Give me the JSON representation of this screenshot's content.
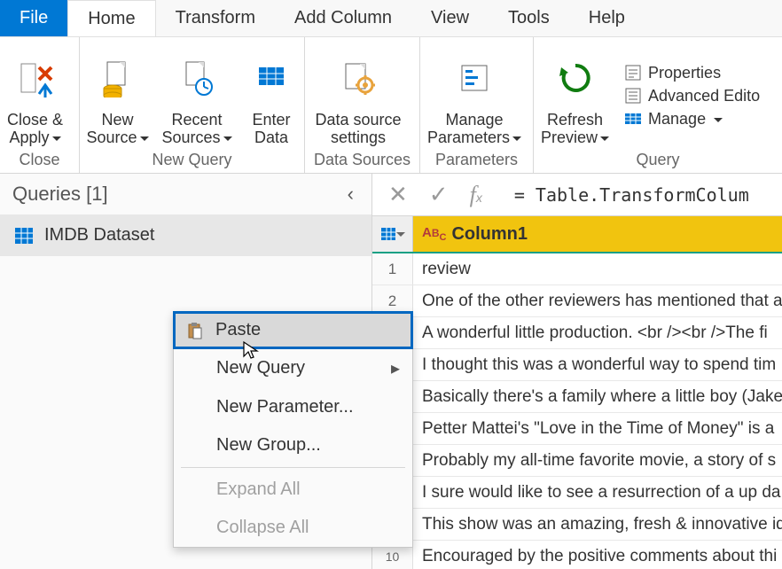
{
  "menubar": {
    "file": "File",
    "tabs": [
      "Home",
      "Transform",
      "Add Column",
      "View",
      "Tools",
      "Help"
    ]
  },
  "ribbon": {
    "close": {
      "label": "Close &\nApply",
      "group": "Close"
    },
    "new_query": {
      "new_source": "New\nSource",
      "recent_sources": "Recent\nSources",
      "enter_data": "Enter\nData",
      "group": "New Query"
    },
    "data_sources": {
      "settings": "Data source\nsettings",
      "group": "Data Sources"
    },
    "parameters": {
      "manage": "Manage\nParameters",
      "group": "Parameters"
    },
    "query": {
      "refresh": "Refresh\nPreview",
      "properties": "Properties",
      "advanced": "Advanced Edito",
      "manage": "Manage",
      "group": "Query"
    }
  },
  "sidebar": {
    "title": "Queries [1]",
    "items": [
      {
        "label": "IMDB Dataset"
      }
    ]
  },
  "context_menu": {
    "paste": "Paste",
    "new_query": "New Query",
    "new_parameter": "New Parameter...",
    "new_group": "New Group...",
    "expand_all": "Expand All",
    "collapse_all": "Collapse All"
  },
  "formula": {
    "text": "= Table.TransformColum"
  },
  "table": {
    "column": "Column1",
    "rows": [
      "review",
      "One of the other reviewers has mentioned that a",
      "A wonderful little production. <br /><br />The fi",
      "I thought this was a wonderful way to spend tim",
      "Basically there's a family where a little boy (Jake",
      "Petter Mattei's \"Love in the Time of Money\" is a",
      "Probably my all-time favorite movie, a story of s",
      "I sure would like to see a resurrection of a up da",
      "This show was an amazing, fresh & innovative id",
      "Encouraged by the positive comments about thi"
    ]
  }
}
